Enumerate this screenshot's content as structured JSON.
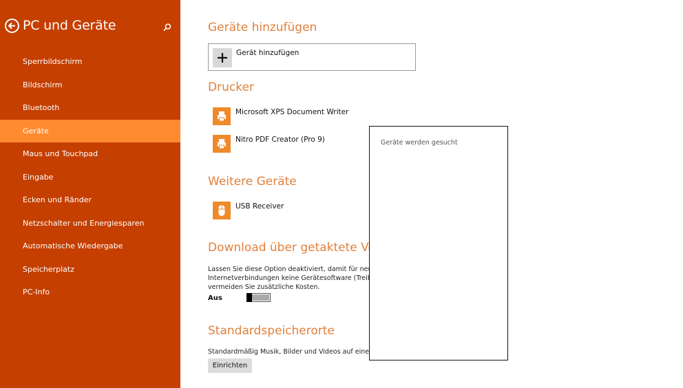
{
  "sidebar": {
    "title": "PC und Geräte",
    "back_icon": "back-arrow-icon",
    "search_icon": "search-icon",
    "items": [
      {
        "label": "Sperrbildschirm",
        "active": false
      },
      {
        "label": "Bildschirm",
        "active": false
      },
      {
        "label": "Bluetooth",
        "active": false
      },
      {
        "label": "Geräte",
        "active": true
      },
      {
        "label": "Maus und Touchpad",
        "active": false
      },
      {
        "label": "Eingabe",
        "active": false
      },
      {
        "label": "Ecken und Ränder",
        "active": false
      },
      {
        "label": "Netzschalter und Energiesparen",
        "active": false
      },
      {
        "label": "Automatische Wiedergabe",
        "active": false
      },
      {
        "label": "Speicherplatz",
        "active": false
      },
      {
        "label": "PC-Info",
        "active": false
      }
    ],
    "colors": {
      "background": "#c53f00",
      "active": "#ff8a2f"
    }
  },
  "main": {
    "add_section": {
      "title": "Geräte hinzufügen",
      "button_label": "Gerät hinzufügen"
    },
    "printers": {
      "title": "Drucker",
      "devices": [
        {
          "name": "Microsoft XPS Document Writer",
          "icon": "printer-icon"
        },
        {
          "name": "Nitro PDF Creator (Pro 9)",
          "icon": "printer-icon"
        }
      ]
    },
    "other": {
      "title": "Weitere Geräte",
      "devices": [
        {
          "name": "USB Receiver",
          "icon": "mouse-icon"
        }
      ]
    },
    "metered": {
      "title": "Download über getaktete Verbi",
      "description_lines": [
        "Lassen Sie diese Option deaktiviert, damit für neue Gerä",
        "Internetverbindungen keine Gerätesoftware (Treiber, Info",
        "vermeiden Sie zusätzliche Kosten."
      ],
      "toggle_label": "Aus",
      "toggle_on": false
    },
    "storage": {
      "title": "Standardspeicherorte",
      "description": "Standardmäßig Musik, Bilder und Videos auf einem Wec",
      "button_label": "Einrichten"
    },
    "accent_color": "#e2803a"
  },
  "popup": {
    "status": "Geräte werden gesucht"
  }
}
